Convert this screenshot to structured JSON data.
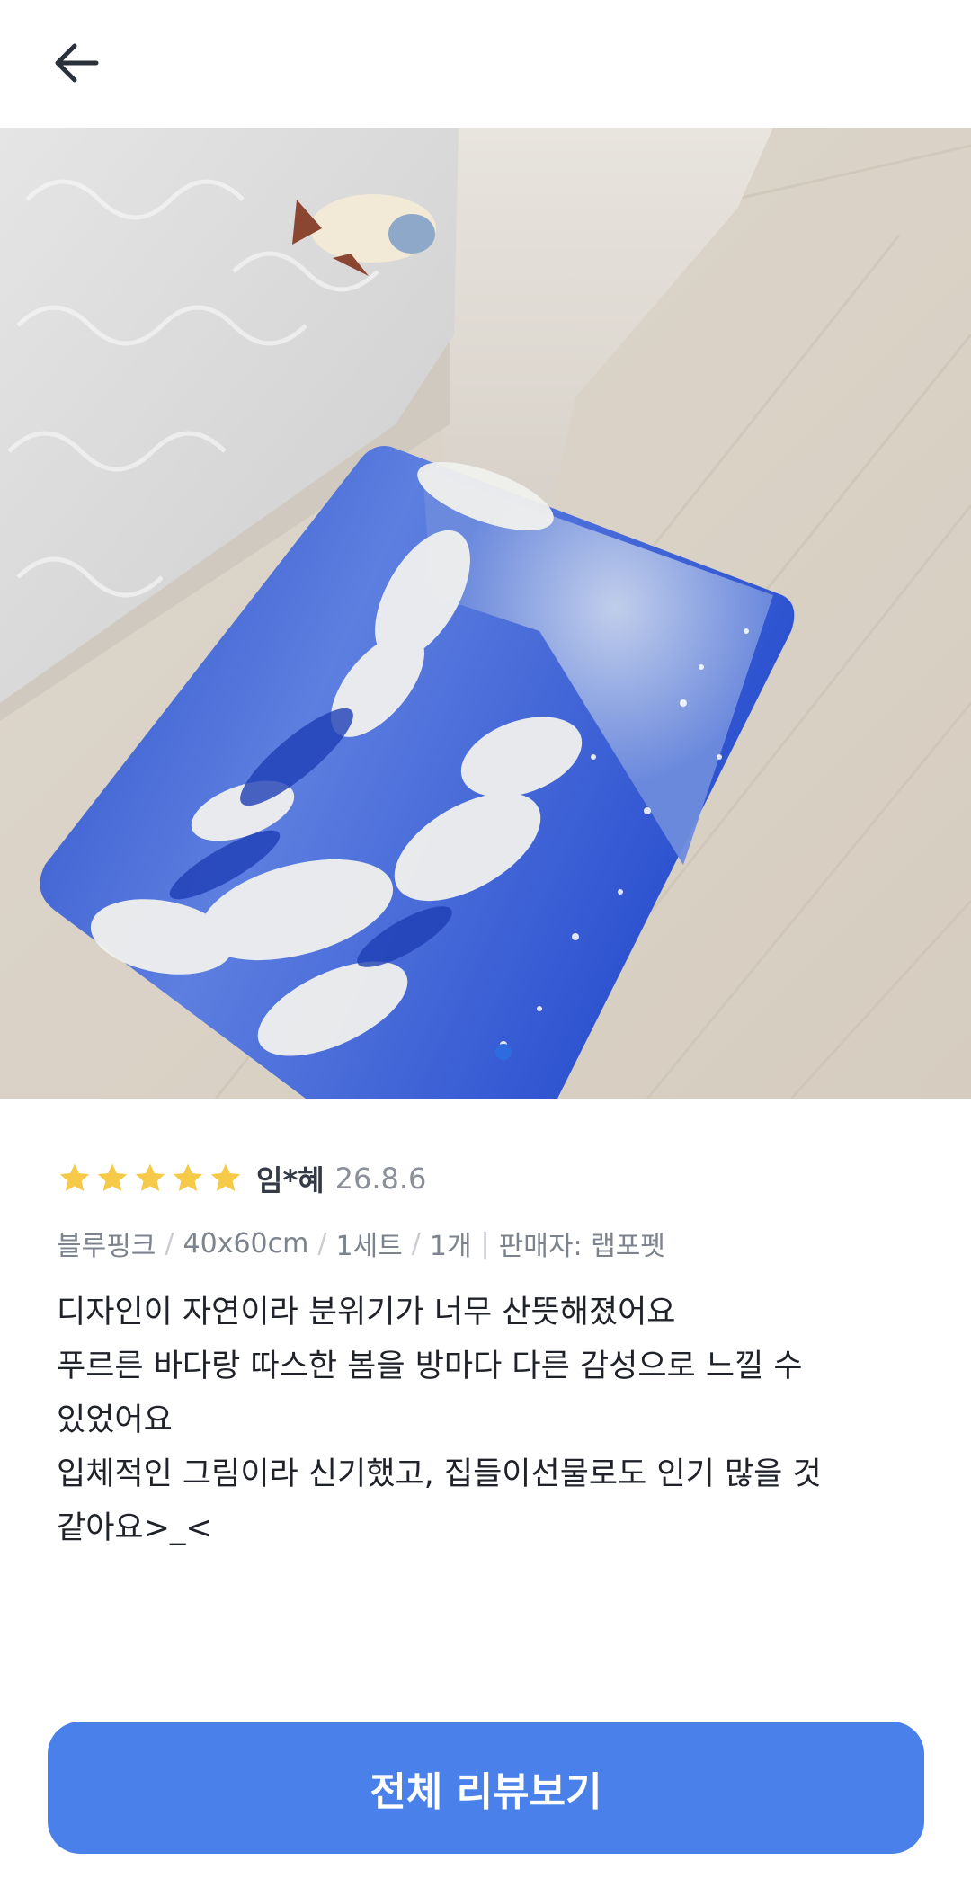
{
  "header": {
    "back_icon": "arrow-left-icon"
  },
  "photo": {
    "alt": "Bath mat with blue wave design on wooden floor",
    "page_indicator_color": "#2f6be0"
  },
  "review": {
    "rating": 5,
    "rating_max": 5,
    "star_color": "#f7c948",
    "reviewer": "임*혜",
    "date": "26.8.6",
    "options": [
      "블루핑크",
      "40x60cm",
      "1세트",
      "1개"
    ],
    "option_separator": "/",
    "seller_label": "판매자: 랩포펫",
    "body_lines": [
      "디자인이 자연이라 분위기가 너무 산뜻해졌어요",
      "푸르른 바다랑 따스한 봄을 방마다 다른 감성으로 느낄 수",
      "있었어요",
      "입체적인 그림이라 신기했고, 집들이선물로도 인기 많을 것",
      "같아요>_<"
    ]
  },
  "cta": {
    "label": "전체 리뷰보기",
    "color": "#4a80ea"
  }
}
